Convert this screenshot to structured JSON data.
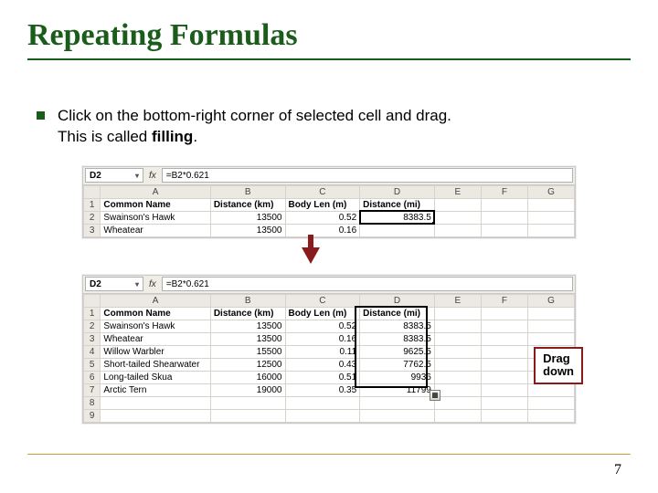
{
  "title": "Repeating Formulas",
  "bullet": {
    "line1": "Click on the bottom-right corner of selected cell and drag.",
    "line2_prefix": "This is called ",
    "line2_bold": "filling",
    "line2_suffix": "."
  },
  "sheet1": {
    "namebox": "D2",
    "formula": "=B2*0.621",
    "cols": [
      "A",
      "B",
      "C",
      "D",
      "E",
      "F",
      "G"
    ],
    "headers": {
      "A": "Common Name",
      "B": "Distance (km)",
      "C": "Body Len (m)",
      "D": "Distance (mi)"
    },
    "rows": [
      {
        "n": "1",
        "A": "Common Name",
        "B": "Distance (km)",
        "C": "Body Len (m)",
        "D": "Distance (mi)"
      },
      {
        "n": "2",
        "A": "Swainson's Hawk",
        "B": "13500",
        "C": "0.52",
        "D": "8383.5"
      },
      {
        "n": "3",
        "A": "Wheatear",
        "B": "13500",
        "C": "0.16",
        "D": ""
      }
    ],
    "selected_cell": "D2"
  },
  "sheet2": {
    "namebox": "D2",
    "formula": "=B2*0.621",
    "cols": [
      "A",
      "B",
      "C",
      "D",
      "E",
      "F",
      "G"
    ],
    "rows": [
      {
        "n": "1",
        "A": "Common Name",
        "B": "Distance (km)",
        "C": "Body Len (m)",
        "D": "Distance (mi)"
      },
      {
        "n": "2",
        "A": "Swainson's Hawk",
        "B": "13500",
        "C": "0.52",
        "D": "8383.5"
      },
      {
        "n": "3",
        "A": "Wheatear",
        "B": "13500",
        "C": "0.16",
        "D": "8383.5"
      },
      {
        "n": "4",
        "A": "Willow Warbler",
        "B": "15500",
        "C": "0.11",
        "D": "9625.5"
      },
      {
        "n": "5",
        "A": "Short-tailed Shearwater",
        "B": "12500",
        "C": "0.43",
        "D": "7762.5"
      },
      {
        "n": "6",
        "A": "Long-tailed Skua",
        "B": "16000",
        "C": "0.51",
        "D": "9936"
      },
      {
        "n": "7",
        "A": "Arctic Tern",
        "B": "19000",
        "C": "0.35",
        "D": "11799"
      },
      {
        "n": "8",
        "A": "",
        "B": "",
        "C": "",
        "D": ""
      },
      {
        "n": "9",
        "A": "",
        "B": "",
        "C": "",
        "D": ""
      }
    ],
    "selected_range": "D2:D7"
  },
  "drag_label": {
    "line1": "Drag",
    "line2": "down"
  },
  "page_number": "7"
}
